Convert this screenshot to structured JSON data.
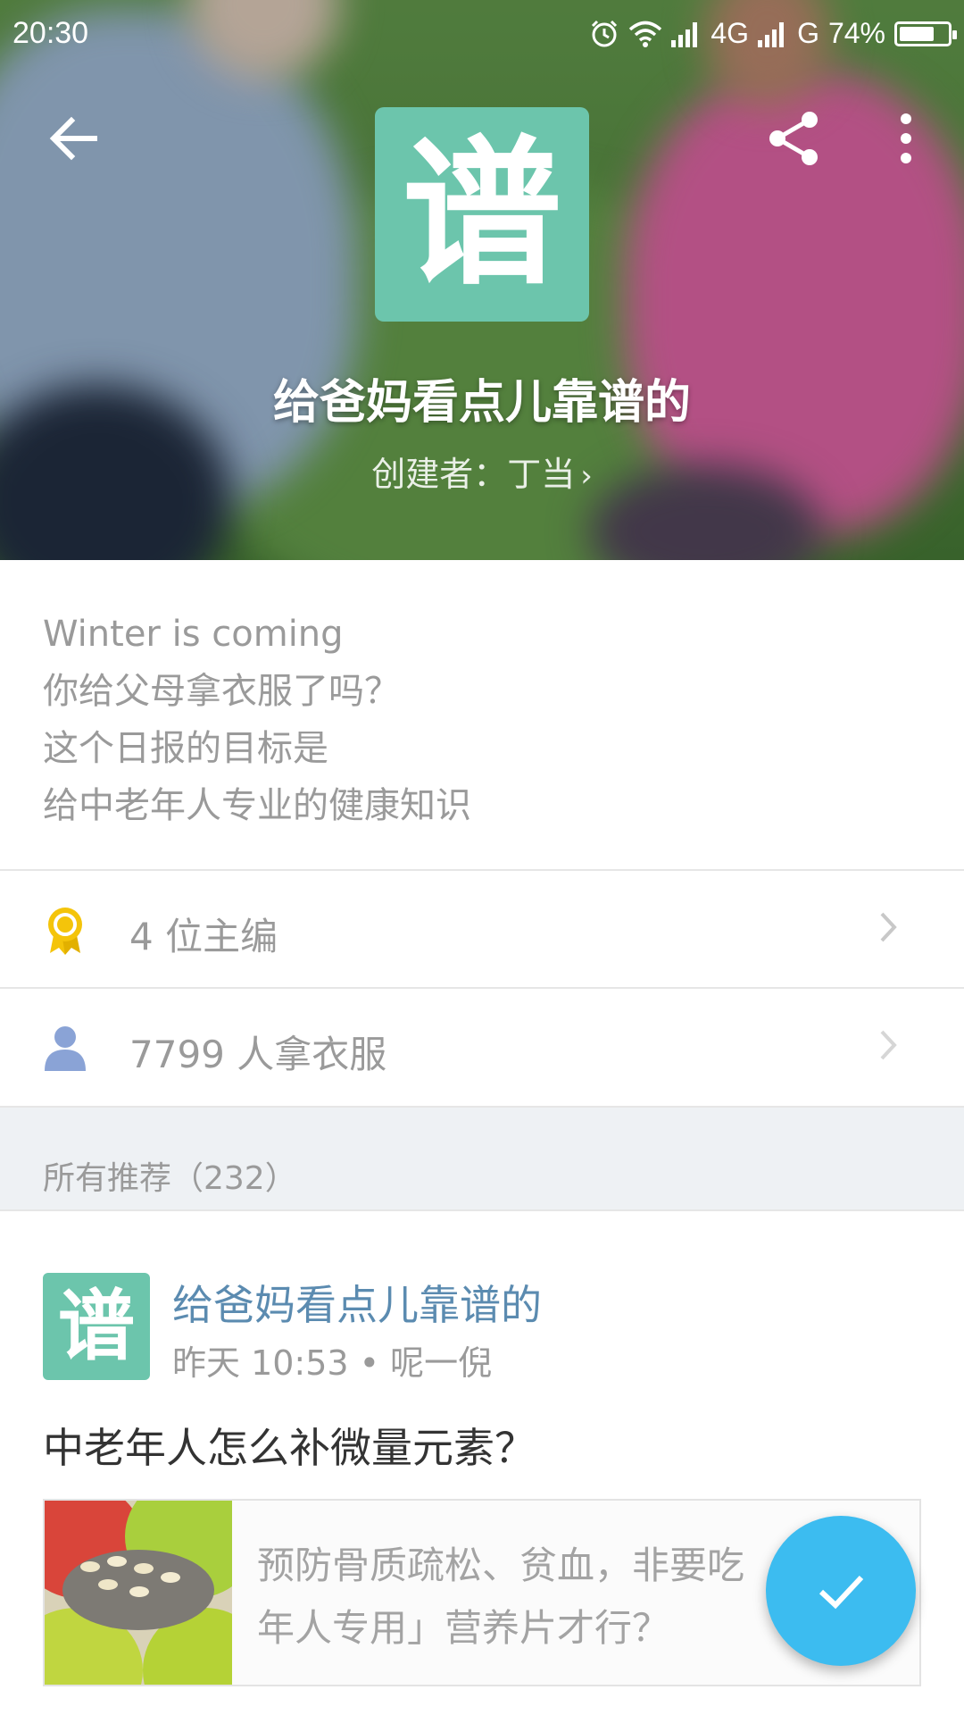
{
  "status_bar": {
    "time": "20:30",
    "network_1": "4G",
    "network_2": "G",
    "battery": "74%",
    "battery_level": 0.74
  },
  "header": {
    "logo_char": "谱",
    "title": "给爸妈看点儿靠谱的",
    "creator": "创建者：丁当",
    "icons": [
      "back-arrow-icon",
      "share-icon",
      "more-vert-icon"
    ]
  },
  "description": [
    "Winter is coming",
    "你给父母拿衣服了吗？",
    "这个日报的目标是",
    "给中老年人专业的健康知识"
  ],
  "rows": [
    {
      "icon": "medal-icon",
      "label": "4 位主编"
    },
    {
      "icon": "person-icon",
      "label": "7799 人拿衣服"
    }
  ],
  "section": {
    "title": "所有推荐（232）"
  },
  "card": {
    "logo_char": "谱",
    "name": "给爸妈看点儿靠谱的",
    "meta": "昨天 10:53 • 呢一倪",
    "headline": "中老年人怎么补微量元素？",
    "article_line_1": "预防骨质疏松、贫血，非要吃",
    "article_line_2": "年人专用」营养片才行？"
  },
  "colors": {
    "brand": "#6cc5ac",
    "fab": "#3cbcf0",
    "link": "#5b8bb0",
    "medal": "#f4c40a",
    "person": "#8aa3d6"
  }
}
